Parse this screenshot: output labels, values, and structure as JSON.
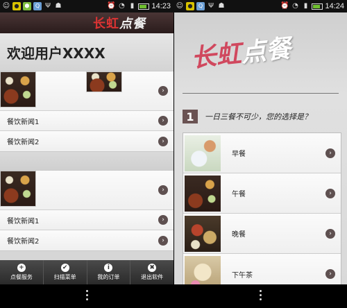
{
  "status_bar": {
    "left_time": "14:23",
    "right_time": "14:24",
    "icons": [
      "chat-icon",
      "hangouts-icon",
      "hexagon-icon",
      "usb-icon",
      "android-icon",
      "alarm-icon",
      "wifi-icon",
      "signal-icon",
      "battery-icon"
    ]
  },
  "left_screen": {
    "header_logo_red": "长虹",
    "header_logo_white": "点餐",
    "welcome": "欢迎用户XXXX",
    "news_group_1": [
      "餐饮新闻1",
      "餐饮新闻2"
    ],
    "news_group_2": [
      "餐饮新闻1",
      "餐饮新闻2"
    ],
    "tabs": [
      {
        "label": "点餐服务",
        "icon": "plus-icon",
        "glyph": "+"
      },
      {
        "label": "扫描菜单",
        "icon": "check-icon",
        "glyph": "✔"
      },
      {
        "label": "我的订单",
        "icon": "info-icon",
        "glyph": "i"
      },
      {
        "label": "退出软件",
        "icon": "close-icon",
        "glyph": "✖"
      }
    ]
  },
  "right_screen": {
    "logo_red": "长虹",
    "logo_white": "点餐",
    "question_number": "1",
    "question_text": "一日三餐不可少，您的选择是？",
    "meals": [
      "早餐",
      "午餐",
      "晚餐",
      "下午茶"
    ]
  },
  "chevron_glyph": "›"
}
